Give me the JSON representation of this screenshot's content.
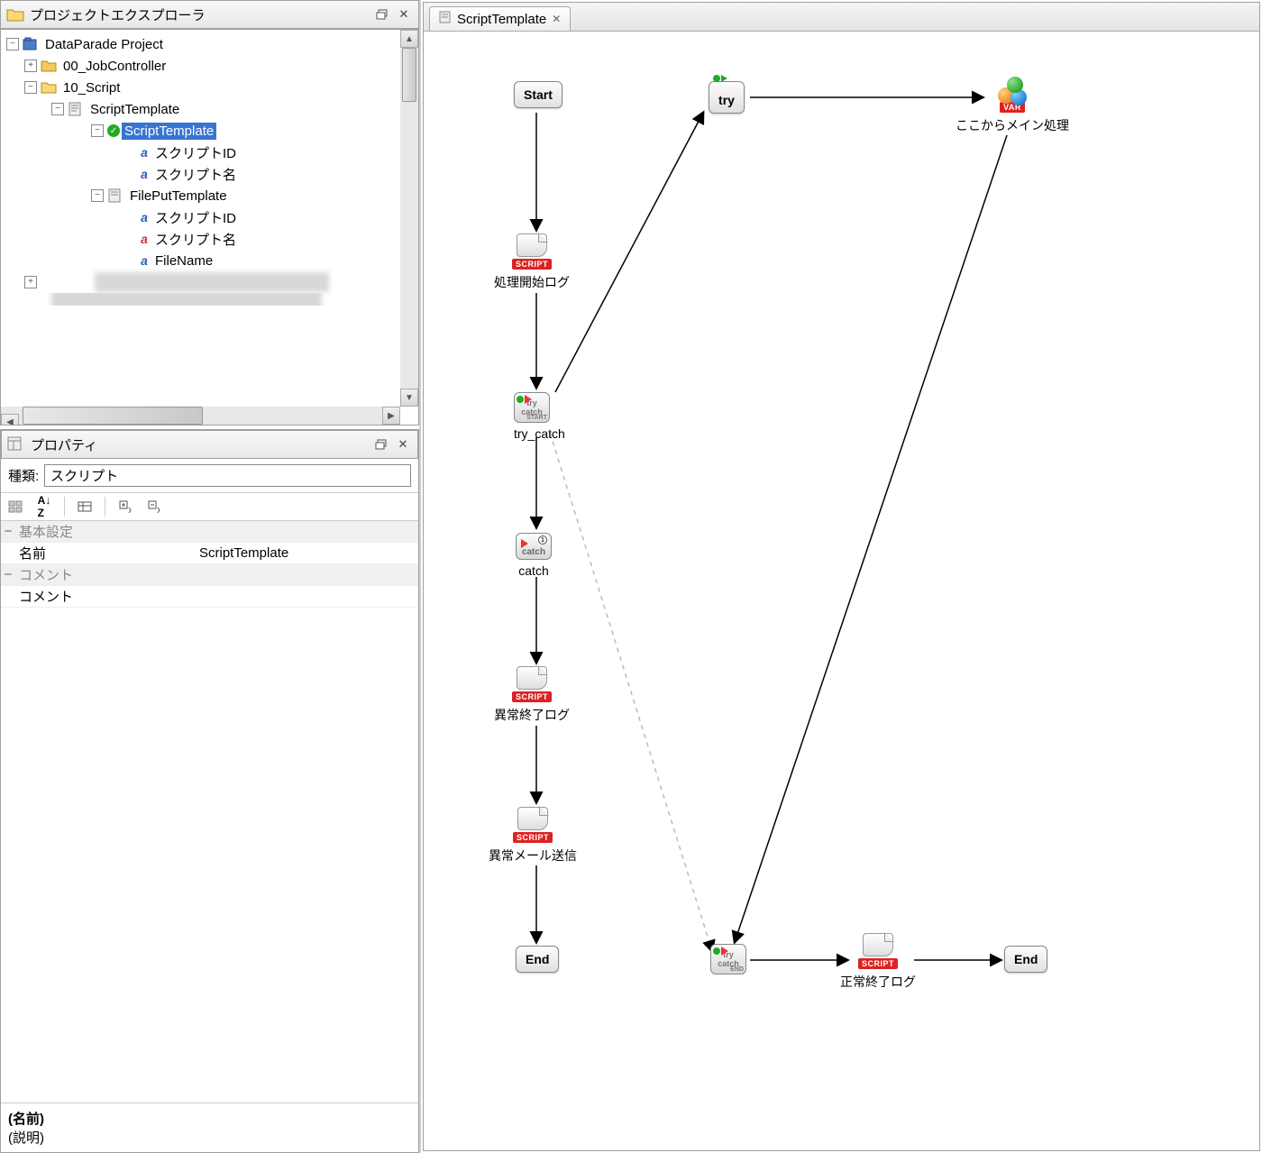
{
  "explorer": {
    "title": "プロジェクトエクスプローラ",
    "tree": {
      "root": "DataParade Project",
      "job_controller": "00_JobController",
      "script_folder": "10_Script",
      "file_script_template": "ScriptTemplate",
      "script_template": "ScriptTemplate",
      "script_id": "スクリプトID",
      "script_name": "スクリプト名",
      "file_put_template": "FilePutTemplate",
      "fp_script_id": "スクリプトID",
      "fp_script_name": "スクリプト名",
      "file_name": "FileName"
    }
  },
  "properties": {
    "title": "プロパティ",
    "type_label": "種類:",
    "type_value": "スクリプト",
    "group_basic": "基本設定",
    "row_name_k": "名前",
    "row_name_v": "ScriptTemplate",
    "group_comment": "コメント",
    "row_comment_k": "コメント",
    "row_comment_v": "",
    "footer_name": "(名前)",
    "footer_desc": "(説明)"
  },
  "editor": {
    "tab_label": "ScriptTemplate",
    "badge_script": "SCRIPT",
    "badge_var": "VAR",
    "nodes": {
      "start": "Start",
      "start_log": "処理開始ログ",
      "try_catch": "try_catch",
      "try": "try",
      "main": "ここからメイン処理",
      "catch": "catch",
      "err_log": "異常終了ログ",
      "err_mail": "異常メール送信",
      "end1": "End",
      "try_catch_end_line1": "try",
      "try_catch_end_line2": "catch",
      "try_catch_end_sub": "END",
      "try_catch_start_sub": "START",
      "ok_log": "正常終了ログ",
      "end2": "End"
    }
  }
}
